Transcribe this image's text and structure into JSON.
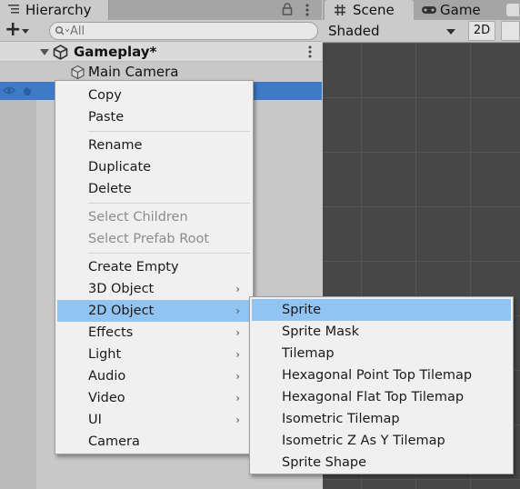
{
  "hierarchy": {
    "tab_label": "Hierarchy",
    "search_placeholder": "All",
    "scene_name": "Gameplay*",
    "objects": [
      "Main Camera"
    ]
  },
  "scene_view": {
    "tab_scene": "Scene",
    "tab_game": "Game",
    "shading_mode": "Shaded",
    "mode_2d_label": "2D",
    "background_color": "#474747"
  },
  "context_menu": {
    "items": [
      {
        "label": "Copy",
        "enabled": true
      },
      {
        "label": "Paste",
        "enabled": true
      },
      {
        "label": "Rename",
        "enabled": true
      },
      {
        "label": "Duplicate",
        "enabled": true
      },
      {
        "label": "Delete",
        "enabled": true
      },
      {
        "label": "Select Children",
        "enabled": false
      },
      {
        "label": "Select Prefab Root",
        "enabled": false
      },
      {
        "label": "Create Empty",
        "enabled": true
      },
      {
        "label": "3D Object",
        "enabled": true,
        "submenu": true
      },
      {
        "label": "2D Object",
        "enabled": true,
        "submenu": true,
        "highlighted": true
      },
      {
        "label": "Effects",
        "enabled": true,
        "submenu": true
      },
      {
        "label": "Light",
        "enabled": true,
        "submenu": true
      },
      {
        "label": "Audio",
        "enabled": true,
        "submenu": true
      },
      {
        "label": "Video",
        "enabled": true,
        "submenu": true
      },
      {
        "label": "UI",
        "enabled": true,
        "submenu": true
      },
      {
        "label": "Camera",
        "enabled": true
      }
    ],
    "submenu_arrow": "›"
  },
  "submenu_2d": {
    "items": [
      {
        "label": "Sprite",
        "highlighted": true
      },
      {
        "label": "Sprite Mask"
      },
      {
        "label": "Tilemap"
      },
      {
        "label": "Hexagonal Point Top Tilemap"
      },
      {
        "label": "Hexagonal Flat Top Tilemap"
      },
      {
        "label": "Isometric Tilemap"
      },
      {
        "label": "Isometric Z As Y Tilemap"
      },
      {
        "label": "Sprite Shape"
      }
    ]
  },
  "colors": {
    "selection": "#3f7ac6",
    "menu_highlight": "#92c4f2",
    "disabled_text": "#8c8c8c"
  }
}
